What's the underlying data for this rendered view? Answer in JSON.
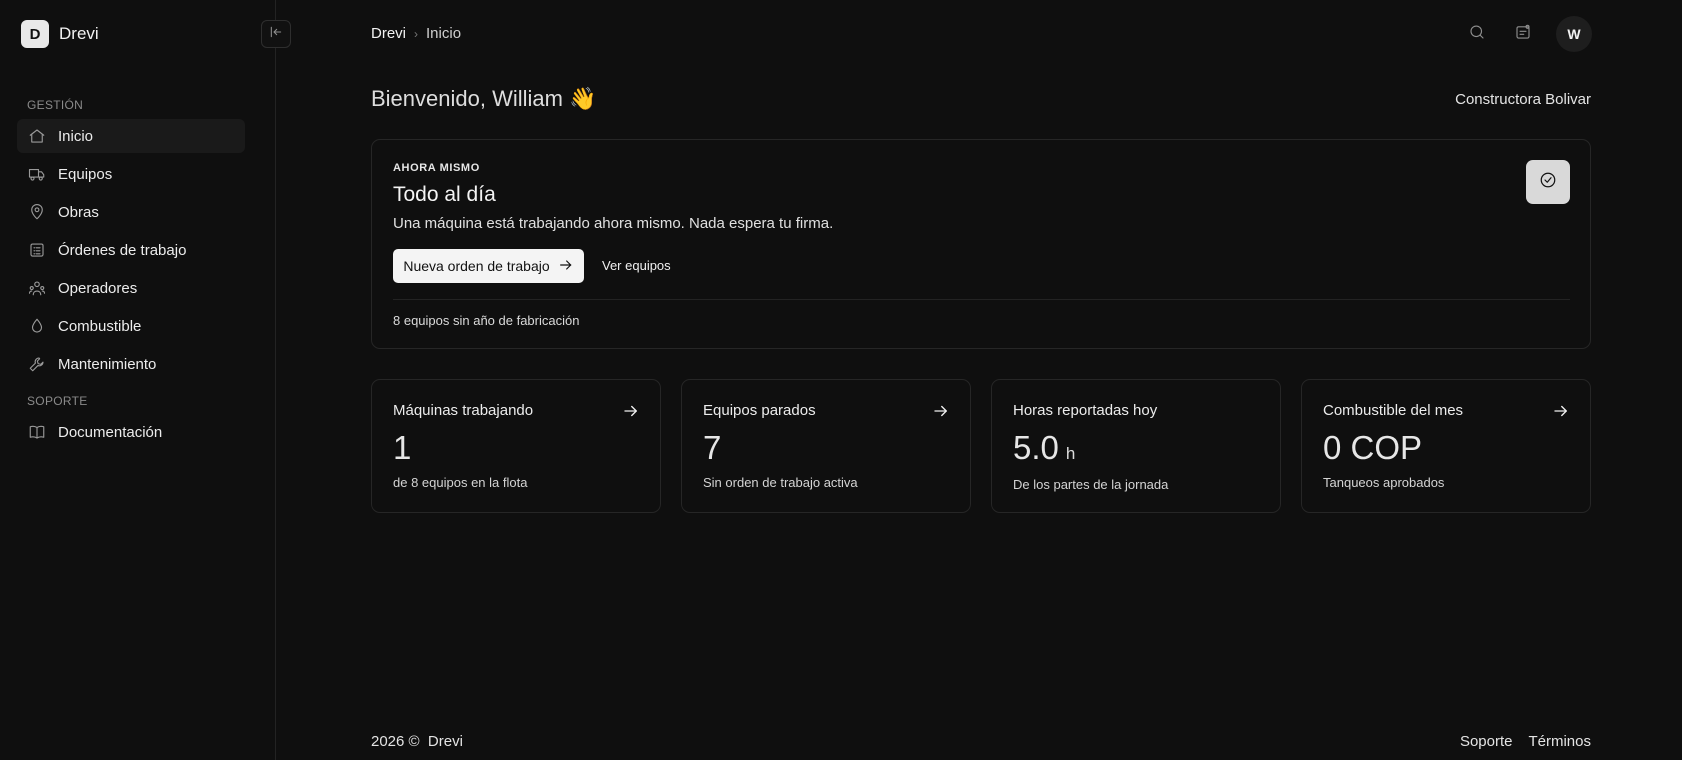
{
  "brand": {
    "logo_letter": "D",
    "name": "Drevi"
  },
  "sidebar": {
    "section_gestion": "GESTIÓN",
    "section_soporte": "SOPORTE",
    "items": [
      {
        "label": "Inicio",
        "icon": "home-icon",
        "active": true
      },
      {
        "label": "Equipos",
        "icon": "truck-icon"
      },
      {
        "label": "Obras",
        "icon": "map-pin-icon"
      },
      {
        "label": "Órdenes de trabajo",
        "icon": "clipboard-list-icon"
      },
      {
        "label": "Operadores",
        "icon": "users-icon"
      },
      {
        "label": "Combustible",
        "icon": "droplet-icon"
      },
      {
        "label": "Mantenimiento",
        "icon": "wrench-icon"
      }
    ],
    "support_items": [
      {
        "label": "Documentación",
        "icon": "book-icon"
      }
    ]
  },
  "header": {
    "breadcrumb_root": "Drevi",
    "breadcrumb_current": "Inicio",
    "avatar_initial": "W"
  },
  "main": {
    "welcome": "Bienvenido, William 👋",
    "company": "Constructora Bolivar"
  },
  "hero": {
    "eyebrow": "AHORA MISMO",
    "title": "Todo al día",
    "description": "Una máquina está trabajando ahora mismo. Nada espera tu firma.",
    "primary_button": "Nueva orden de trabajo",
    "secondary_button": "Ver equipos",
    "footnote": "8 equipos sin año de fabricación"
  },
  "cards": [
    {
      "title": "Máquinas trabajando",
      "value": "1",
      "unit": "",
      "subtitle": "de 8 equipos en la flota",
      "has_arrow": true
    },
    {
      "title": "Equipos parados",
      "value": "7",
      "unit": "",
      "subtitle": "Sin orden de trabajo activa",
      "has_arrow": true
    },
    {
      "title": "Horas reportadas hoy",
      "value": "5.0",
      "unit": "h",
      "subtitle": "De los partes de la jornada",
      "has_arrow": false
    },
    {
      "title": "Combustible del mes",
      "value": "0 COP",
      "unit": "",
      "subtitle": "Tanqueos aprobados",
      "has_arrow": true
    }
  ],
  "footer": {
    "copyright": "2026 ©  Drevi",
    "links": [
      "Soporte",
      "Términos"
    ]
  }
}
